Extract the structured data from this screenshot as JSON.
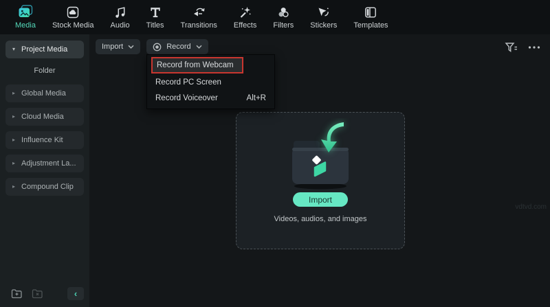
{
  "colors": {
    "accent": "#54d8b9",
    "annotation_red": "#c9362f",
    "import_button_bg": "#66e7c3",
    "topbar_bg": "#0e1113",
    "sidebar_bg": "#1b2022",
    "content_bg": "#141719"
  },
  "icons": {
    "caret_down": "▾",
    "caret_right": "▸",
    "collapse": "‹"
  },
  "topbar": {
    "tabs": [
      {
        "label": "Media",
        "icon": "media-icon",
        "active": true
      },
      {
        "label": "Stock Media",
        "icon": "stock-media-icon",
        "active": false
      },
      {
        "label": "Audio",
        "icon": "audio-icon",
        "active": false
      },
      {
        "label": "Titles",
        "icon": "titles-icon",
        "active": false
      },
      {
        "label": "Transitions",
        "icon": "transitions-icon",
        "active": false
      },
      {
        "label": "Effects",
        "icon": "effects-icon",
        "active": false
      },
      {
        "label": "Filters",
        "icon": "filters-icon",
        "active": false
      },
      {
        "label": "Stickers",
        "icon": "stickers-icon",
        "active": false
      },
      {
        "label": "Templates",
        "icon": "templates-icon",
        "active": false
      }
    ]
  },
  "sidebar": {
    "items": [
      {
        "label": "Project Media",
        "selected": true
      },
      {
        "label": "Global Media",
        "selected": false
      },
      {
        "label": "Cloud Media",
        "selected": false
      },
      {
        "label": "Influence Kit",
        "selected": false
      },
      {
        "label": "Adjustment La...",
        "selected": false
      },
      {
        "label": "Compound Clip",
        "selected": false
      }
    ],
    "folder_section_label": "Folder"
  },
  "content": {
    "toolbar": {
      "import_label": "Import",
      "record_label": "Record"
    },
    "record_menu": {
      "items": [
        {
          "label": "Record from Webcam",
          "shortcut": "",
          "highlighted": true
        },
        {
          "label": "Record PC Screen",
          "shortcut": "",
          "highlighted": false
        },
        {
          "label": "Record Voiceover",
          "shortcut": "Alt+R",
          "highlighted": false
        }
      ]
    },
    "dropzone": {
      "import_button_label": "Import",
      "caption": "Videos, audios, and images"
    }
  },
  "watermark": "vdtvd.com"
}
